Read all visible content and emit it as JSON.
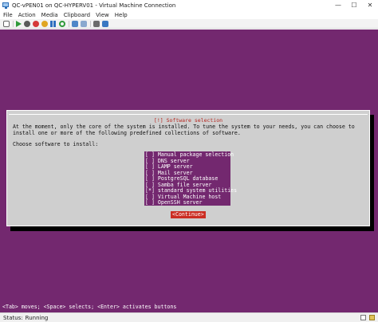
{
  "window": {
    "title": "QC-vPEN01 on QC-HYPERV01 - Virtual Machine Connection",
    "minimize_glyph": "—",
    "maximize_glyph": "☐",
    "close_glyph": "✕"
  },
  "menu": [
    "File",
    "Action",
    "Media",
    "Clipboard",
    "View",
    "Help"
  ],
  "toolbar_icons": [
    "ctrl-alt-del-icon",
    "start-icon",
    "turn-off-icon",
    "shut-down-icon",
    "save-state-icon",
    "pause-icon",
    "reset-icon",
    "checkpoint-icon",
    "revert-icon",
    "enhanced-session-icon",
    "share-icon"
  ],
  "dialog": {
    "title": "[!] Software selection",
    "description": "At the moment, only the core of the system is installed. To tune the system to your needs, you can choose to install one or more of the following predefined collections of software.",
    "prompt": "Choose software to install:",
    "items": [
      {
        "label": "[ ] Manual package selection"
      },
      {
        "label": "[ ] DNS server"
      },
      {
        "label": "[ ] LAMP server"
      },
      {
        "label": "[ ] Mail server"
      },
      {
        "label": "[ ] PostgreSQL database"
      },
      {
        "label": "[ ] Samba file server"
      },
      {
        "label": "[*] standard system utilities"
      },
      {
        "label": "[ ] Virtual Machine host"
      },
      {
        "label": "[ ] OpenSSH server"
      }
    ],
    "continue_label": "<Continue>"
  },
  "key_hint": "<Tab> moves; <Space> selects; <Enter> activates buttons",
  "status": {
    "label": "Status:",
    "value": "Running"
  },
  "colors": {
    "terminal_background": "#73286f",
    "dialog_background": "#cfcfcf",
    "title_accent": "#b7261f",
    "button_accent": "#cb2d22"
  }
}
